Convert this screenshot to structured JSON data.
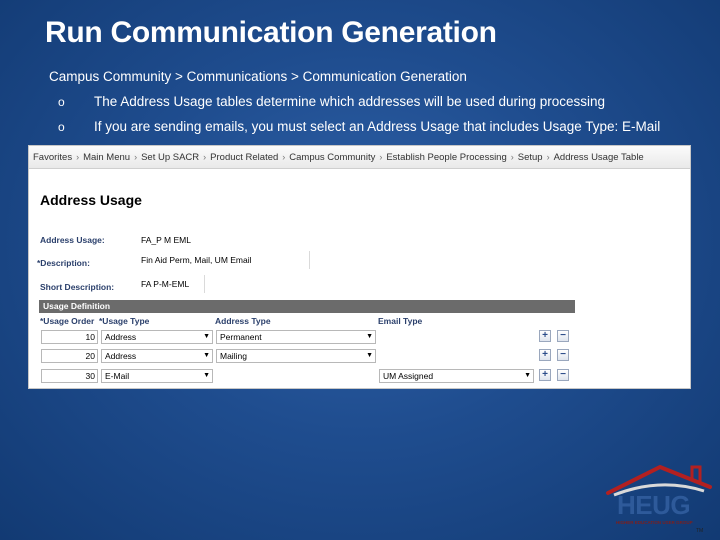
{
  "slide": {
    "title": "Run Communication Generation",
    "breadcrumb": "Campus Community > Communications > Communication Generation",
    "bullets": [
      {
        "marker": "o",
        "text": "The Address Usage tables determine which addresses will be used during processing"
      },
      {
        "marker": "o",
        "text": "If you are sending emails, you must select an Address Usage that includes Usage Type: E-Mail"
      }
    ]
  },
  "screenshot": {
    "nav": [
      "Favorites",
      "Main Menu",
      "Set Up SACR",
      "Product Related",
      "Campus Community",
      "Establish People Processing",
      "Setup",
      "Address Usage Table"
    ],
    "page_title": "Address Usage",
    "fields": {
      "address_usage_label": "Address Usage:",
      "address_usage_value": "FA_P M EML",
      "description_label": "*Description:",
      "description_value": "Fin Aid Perm, Mail, UM Email",
      "short_description_label": "Short Description:",
      "short_description_value": "FA P-M-EML"
    },
    "grid": {
      "title": "Usage Definition",
      "columns": [
        "*Usage Order",
        "*Usage Type",
        "Address Type",
        "Email Type"
      ],
      "rows": [
        {
          "order": "10",
          "usage_type": "Address",
          "address_type": "Permanent",
          "email_type": ""
        },
        {
          "order": "20",
          "usage_type": "Address",
          "address_type": "Mailing",
          "email_type": ""
        },
        {
          "order": "30",
          "usage_type": "E-Mail",
          "address_type": "",
          "email_type": "UM Assigned"
        }
      ],
      "add_symbol": "+",
      "remove_symbol": "−"
    }
  },
  "logo": {
    "text": "HEUG",
    "subtext": "HIGHER EDUCATION USER GROUP",
    "tm": "TM"
  }
}
